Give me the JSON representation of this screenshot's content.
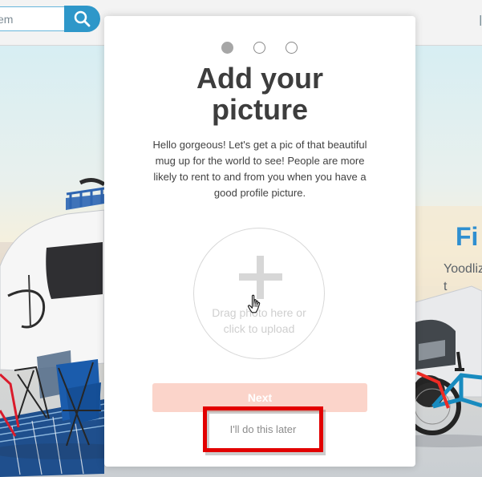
{
  "search": {
    "value": "em",
    "placeholder": "",
    "button_icon": "search-icon"
  },
  "hero": {
    "heading": "Fi",
    "subtext_line_1": "Yoodliz",
    "subtext_line_2": "t"
  },
  "modal": {
    "step_indicator": {
      "current_step": 1,
      "total_steps": 3
    },
    "title": "Add your picture",
    "description": "Hello gorgeous! Let's get a pic of that beautiful mug up for the world to see! People are more likely to rent to and from you when you have a good profile picture.",
    "upload_text": "Drag photo here or click to upload",
    "next_button": "Next",
    "later_link": "I'll do this later"
  },
  "colors": {
    "brand_blue": "#2e97c9",
    "next_button_disabled": "#fbd4ca",
    "highlight": "#e20000"
  },
  "icons": {
    "search": "search-icon",
    "plus": "plus-icon",
    "cursor": "hand-cursor-icon"
  }
}
